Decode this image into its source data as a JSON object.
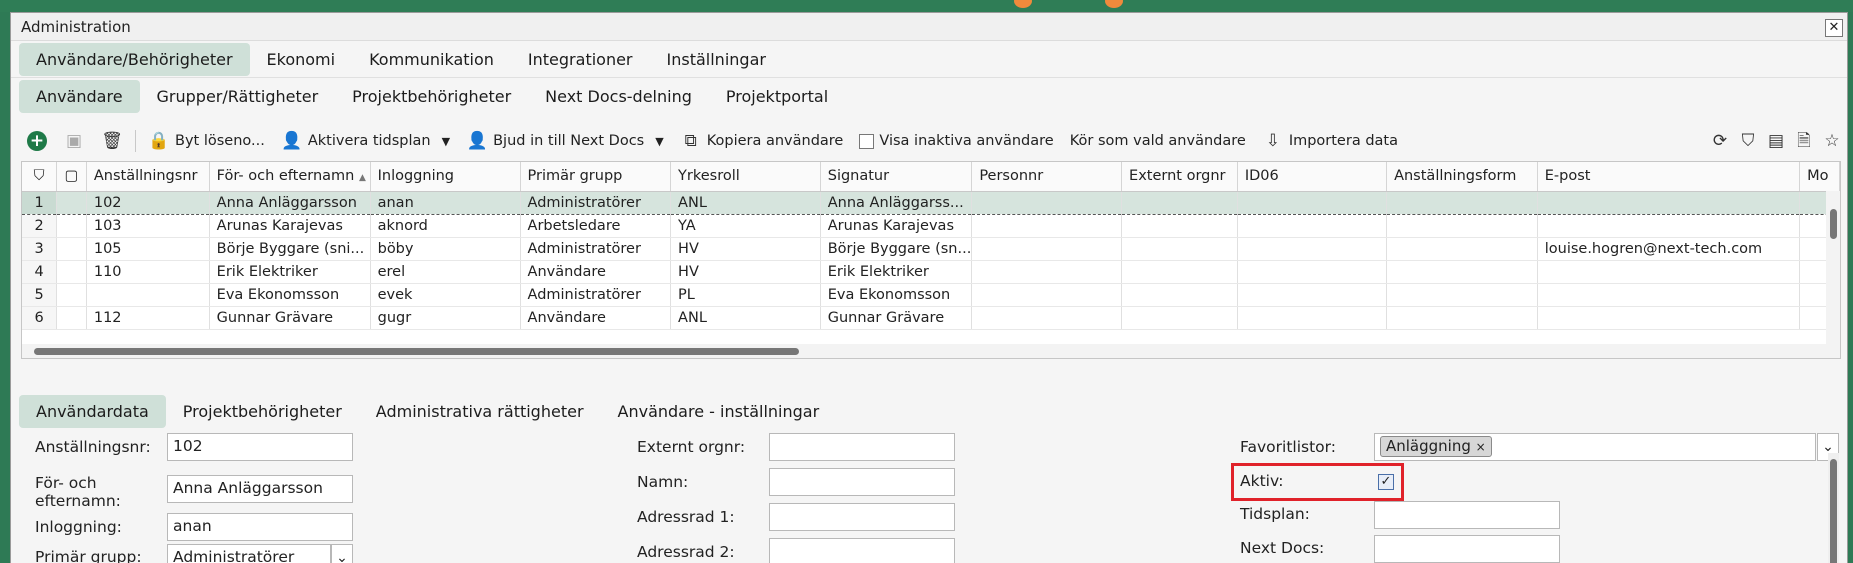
{
  "window": {
    "title": "Administration",
    "close_label": "✕"
  },
  "main_tabs": [
    {
      "label": "Användare/Behörigheter"
    },
    {
      "label": "Ekonomi"
    },
    {
      "label": "Kommunikation"
    },
    {
      "label": "Integrationer"
    },
    {
      "label": "Inställningar"
    }
  ],
  "sub_tabs": [
    {
      "label": "Användare"
    },
    {
      "label": "Grupper/Rättigheter"
    },
    {
      "label": "Projektbehörigheter"
    },
    {
      "label": "Next Docs-delning"
    },
    {
      "label": "Projektportal"
    }
  ],
  "toolbar": {
    "change_password": "Byt löseno...",
    "activate_schedule": "Aktivera tidsplan",
    "invite_nextdocs": "Bjud in till Next Docs",
    "copy_user": "Kopiera användare",
    "show_inactive": "Visa inaktiva användare",
    "run_as": "Kör som vald användare",
    "import_data": "Importera data"
  },
  "grid": {
    "columns": [
      "Anställningsnr",
      "För- och efternamn",
      "Inloggning",
      "Primär grupp",
      "Yrkesroll",
      "Signatur",
      "Personnr",
      "Externt orgnr",
      "ID06",
      "Anställningsform",
      "E-post",
      "Mo"
    ],
    "rows": [
      {
        "num": "1",
        "cells": [
          "102",
          "Anna Anläggarsson",
          "anan",
          "Administratörer",
          "ANL",
          "Anna Anläggarss...",
          "",
          "",
          "",
          "",
          "",
          ""
        ]
      },
      {
        "num": "2",
        "cells": [
          "103",
          "Arunas Karajevas",
          "aknord",
          "Arbetsledare",
          "YA",
          "Arunas Karajevas",
          "",
          "",
          "",
          "",
          "",
          ""
        ]
      },
      {
        "num": "3",
        "cells": [
          "105",
          "Börje Byggare (sni...",
          "böby",
          "Administratörer",
          "HV",
          "Börje Byggare (sn...",
          "",
          "",
          "",
          "",
          "louise.hogren@next-tech.com",
          ""
        ]
      },
      {
        "num": "4",
        "cells": [
          "110",
          "Erik Elektriker",
          "erel",
          "Användare",
          "HV",
          "Erik Elektriker",
          "",
          "",
          "",
          "",
          "",
          ""
        ]
      },
      {
        "num": "5",
        "cells": [
          "",
          "Eva Ekonomsson",
          "evek",
          "Administratörer",
          "PL",
          "Eva Ekonomsson",
          "",
          "",
          "",
          "",
          "",
          ""
        ]
      },
      {
        "num": "6",
        "cells": [
          "112",
          "Gunnar Grävare",
          "gugr",
          "Användare",
          "ANL",
          "Gunnar Grävare",
          "",
          "",
          "",
          "",
          "",
          ""
        ]
      }
    ]
  },
  "detail_tabs": [
    {
      "label": "Användardata"
    },
    {
      "label": "Projektbehörigheter"
    },
    {
      "label": "Administrativa rättigheter"
    },
    {
      "label": "Användare - inställningar"
    }
  ],
  "form": {
    "emp_no_label": "Anställningsnr:",
    "emp_no": "102",
    "name_label_1": "För- och",
    "name_label_2": "efternamn:",
    "name": "Anna Anläggarsson",
    "login_label": "Inloggning:",
    "login": "anan",
    "group_label": "Primär grupp:",
    "group": "Administratörer",
    "ext_org_label": "Externt orgnr:",
    "ext_org": "",
    "namn_label": "Namn:",
    "namn": "",
    "addr1_label": "Adressrad 1:",
    "addr1": "",
    "addr2_label": "Adressrad 2:",
    "addr2": "",
    "fav_label": "Favoritlistor:",
    "fav_tag": "Anläggning",
    "fav_tag_x": "×",
    "active_label": "Aktiv:",
    "active_check": "✓",
    "schedule_label": "Tidsplan:",
    "schedule": "",
    "nextdocs_label": "Next Docs:",
    "nextdocs": ""
  }
}
